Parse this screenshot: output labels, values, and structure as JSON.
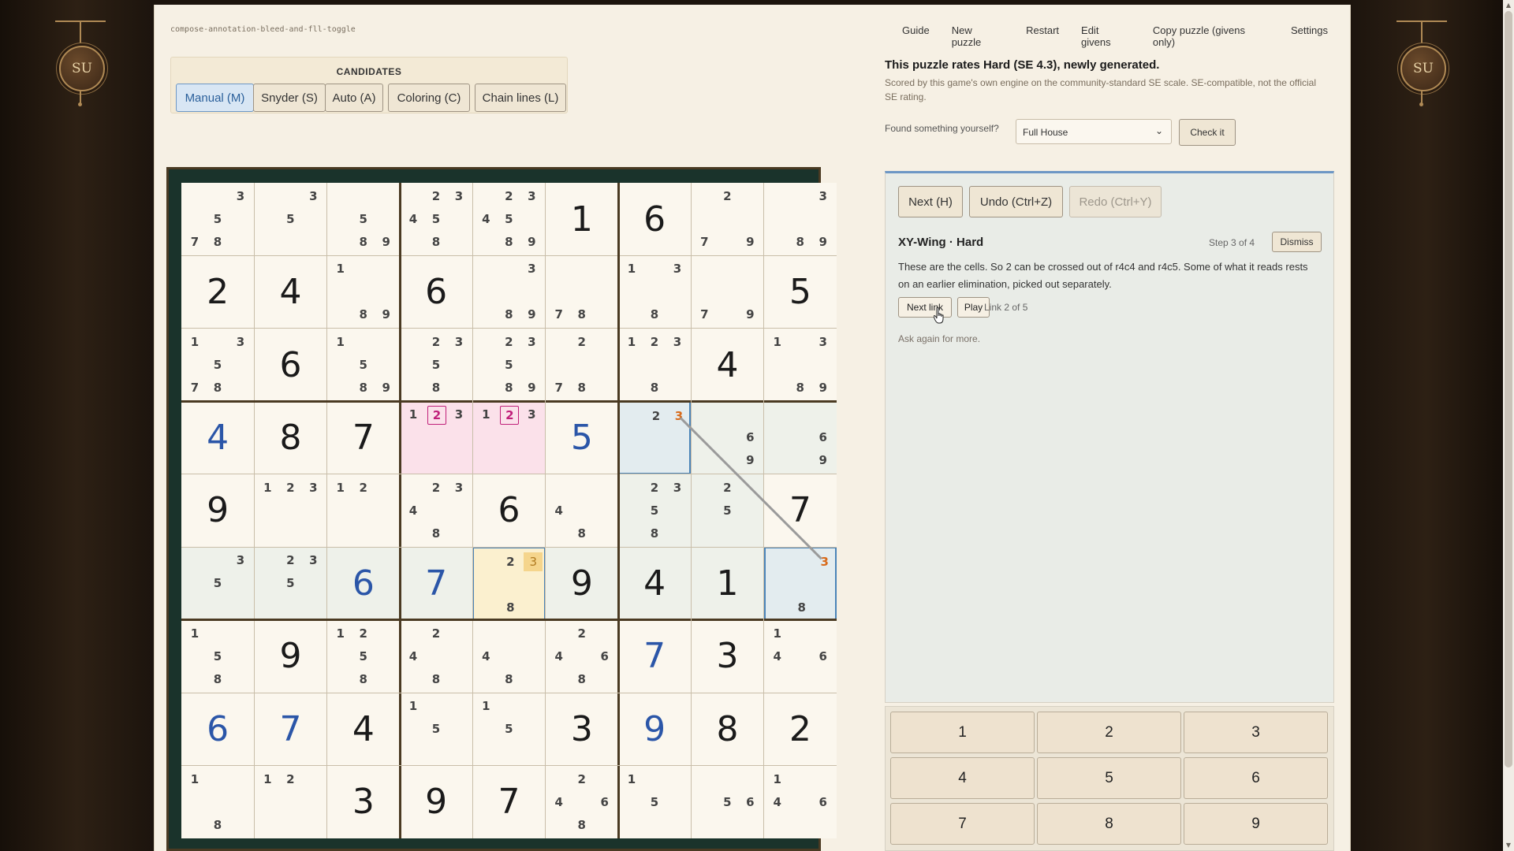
{
  "branding": {
    "emblem_text": "SU"
  },
  "puzzle_id": "compose-annotation-bleed-and-fll-toggle",
  "topnav": [
    "Guide",
    "New puzzle",
    "Restart",
    "Edit givens",
    "Copy puzzle (givens only)",
    "Settings"
  ],
  "candidates": {
    "title": "CANDIDATES",
    "modes": [
      "Manual (M)",
      "Snyder (S)",
      "Auto (A)",
      "Coloring (C)",
      "Chain lines (L)"
    ],
    "active_mode": "Manual (M)"
  },
  "rating": {
    "title": "This puzzle rates Hard (SE 4.3), newly generated.",
    "subtitle": "Scored by this game's own engine on the community-standard SE scale. SE-compatible, not the official SE rating."
  },
  "found": {
    "label": "Found something yourself?",
    "selected": "Full House",
    "check_label": "Check it"
  },
  "hint": {
    "next_label": "Next (H)",
    "undo_label": "Undo (Ctrl+Z)",
    "redo_label": "Redo (Ctrl+Y)",
    "title": "XY-Wing · Hard",
    "step": "Step 3 of 4",
    "dismiss_label": "Dismiss",
    "text": "These are the cells. So 2 can be crossed out of r4c4 and r4c5. Some of what it reads rests on an earlier elimination, picked out separately.",
    "next_link_label": "Next link",
    "play_label": "Play",
    "link_counter": "Link 2 of 5",
    "ask_again": "Ask again for more."
  },
  "numpad": [
    "1",
    "2",
    "3",
    "4",
    "5",
    "6",
    "7",
    "8",
    "9"
  ],
  "colors": {
    "given": "#1a1a1a",
    "user_value": "#2b56a8",
    "elim_bg": "#fbe1ea",
    "elim_box": "#c0207a",
    "pivot_bg": "#fbf0cf",
    "pivot_hl": "#f5d58c",
    "pincer_bg": "#e3ecef",
    "pincer_border": "#4a84b8",
    "chain_line": "#9b9b9b",
    "chain_digit": "#d86a1a",
    "region_bg": "#eef1ea"
  },
  "board": [
    [
      {
        "c": [
          3,
          5,
          7,
          8
        ]
      },
      {
        "c": [
          3,
          5
        ]
      },
      {
        "c": [
          5,
          8,
          9
        ]
      },
      {
        "c": [
          2,
          3,
          4,
          5,
          8
        ]
      },
      {
        "c": [
          2,
          3,
          4,
          5,
          8,
          9
        ]
      },
      {
        "v": "1",
        "g": true
      },
      {
        "v": "6",
        "g": true
      },
      {
        "c": [
          2,
          7,
          9
        ]
      },
      {
        "c": [
          3,
          8,
          9
        ]
      }
    ],
    [
      {
        "v": "2",
        "g": true
      },
      {
        "v": "4",
        "g": true
      },
      {
        "c": [
          1,
          8,
          9
        ]
      },
      {
        "v": "6",
        "g": true
      },
      {
        "c": [
          3,
          8,
          9
        ]
      },
      {
        "c": [
          7,
          8
        ]
      },
      {
        "c": [
          1,
          3,
          8
        ]
      },
      {
        "c": [
          7,
          9
        ]
      },
      {
        "v": "5",
        "g": true
      }
    ],
    [
      {
        "c": [
          1,
          3,
          5,
          7,
          8
        ]
      },
      {
        "v": "6",
        "g": true
      },
      {
        "c": [
          1,
          5,
          8,
          9
        ]
      },
      {
        "c": [
          2,
          3,
          5,
          8
        ]
      },
      {
        "c": [
          2,
          3,
          5,
          8,
          9
        ]
      },
      {
        "c": [
          2,
          7,
          8
        ]
      },
      {
        "c": [
          1,
          2,
          3,
          8
        ]
      },
      {
        "v": "4",
        "g": true
      },
      {
        "c": [
          1,
          3,
          8,
          9
        ]
      }
    ],
    [
      {
        "v": "4",
        "g": false
      },
      {
        "v": "8",
        "g": true
      },
      {
        "v": "7",
        "g": true
      },
      {
        "c": [
          1,
          2,
          3
        ]
      },
      {
        "c": [
          1,
          2,
          3
        ]
      },
      {
        "v": "5",
        "g": false
      },
      {
        "c": [
          2,
          3
        ]
      },
      {
        "c": [
          6,
          9
        ]
      },
      {
        "c": [
          6,
          9
        ]
      }
    ],
    [
      {
        "v": "9",
        "g": true
      },
      {
        "c": [
          1,
          2,
          3
        ]
      },
      {
        "c": [
          1,
          2
        ]
      },
      {
        "c": [
          2,
          3,
          4,
          8
        ]
      },
      {
        "v": "6",
        "g": true
      },
      {
        "c": [
          4,
          8
        ]
      },
      {
        "c": [
          2,
          3,
          5,
          8
        ]
      },
      {
        "c": [
          2,
          5
        ]
      },
      {
        "v": "7",
        "g": true
      }
    ],
    [
      {
        "c": [
          3,
          5
        ]
      },
      {
        "c": [
          2,
          3,
          5
        ]
      },
      {
        "v": "6",
        "g": false
      },
      {
        "v": "7",
        "g": false
      },
      {
        "c": [
          2,
          3,
          8
        ]
      },
      {
        "v": "9",
        "g": true
      },
      {
        "v": "4",
        "g": true
      },
      {
        "v": "1",
        "g": true
      },
      {
        "c": [
          3,
          8
        ]
      }
    ],
    [
      {
        "c": [
          1,
          5,
          8
        ]
      },
      {
        "v": "9",
        "g": true
      },
      {
        "c": [
          1,
          2,
          5,
          8
        ]
      },
      {
        "c": [
          2,
          4,
          8
        ]
      },
      {
        "c": [
          4,
          8
        ]
      },
      {
        "c": [
          2,
          4,
          6,
          8
        ]
      },
      {
        "v": "7",
        "g": false
      },
      {
        "v": "3",
        "g": true
      },
      {
        "c": [
          1,
          4,
          6
        ]
      }
    ],
    [
      {
        "v": "6",
        "g": false
      },
      {
        "v": "7",
        "g": false
      },
      {
        "v": "4",
        "g": true
      },
      {
        "c": [
          1,
          5
        ]
      },
      {
        "c": [
          1,
          5
        ]
      },
      {
        "v": "3",
        "g": true
      },
      {
        "v": "9",
        "g": false
      },
      {
        "v": "8",
        "g": true
      },
      {
        "v": "2",
        "g": true
      }
    ],
    [
      {
        "c": [
          1,
          8
        ]
      },
      {
        "c": [
          1,
          2
        ]
      },
      {
        "v": "3",
        "g": true
      },
      {
        "v": "9",
        "g": true
      },
      {
        "v": "7",
        "g": true
      },
      {
        "c": [
          2,
          4,
          6,
          8
        ]
      },
      {
        "c": [
          1,
          5
        ]
      },
      {
        "c": [
          5,
          6
        ]
      },
      {
        "c": [
          1,
          4,
          6
        ]
      }
    ]
  ],
  "highlights": {
    "eliminated": {
      "cells": [
        [
          3,
          3
        ],
        [
          3,
          4
        ]
      ],
      "digit": 2
    },
    "pivot": {
      "cell": [
        5,
        4
      ],
      "digit": 3
    },
    "pincers": [
      [
        3,
        6
      ],
      [
        5,
        8
      ]
    ],
    "region_tint": [
      [
        3,
        7
      ],
      [
        3,
        8
      ],
      [
        4,
        6
      ],
      [
        4,
        7
      ],
      [
        5,
        0
      ],
      [
        5,
        1
      ],
      [
        5,
        2
      ],
      [
        5,
        3
      ],
      [
        5,
        5
      ],
      [
        5,
        6
      ],
      [
        5,
        7
      ]
    ],
    "chain": {
      "from": [
        3,
        6
      ],
      "to": [
        5,
        8
      ],
      "digit": 3
    }
  }
}
